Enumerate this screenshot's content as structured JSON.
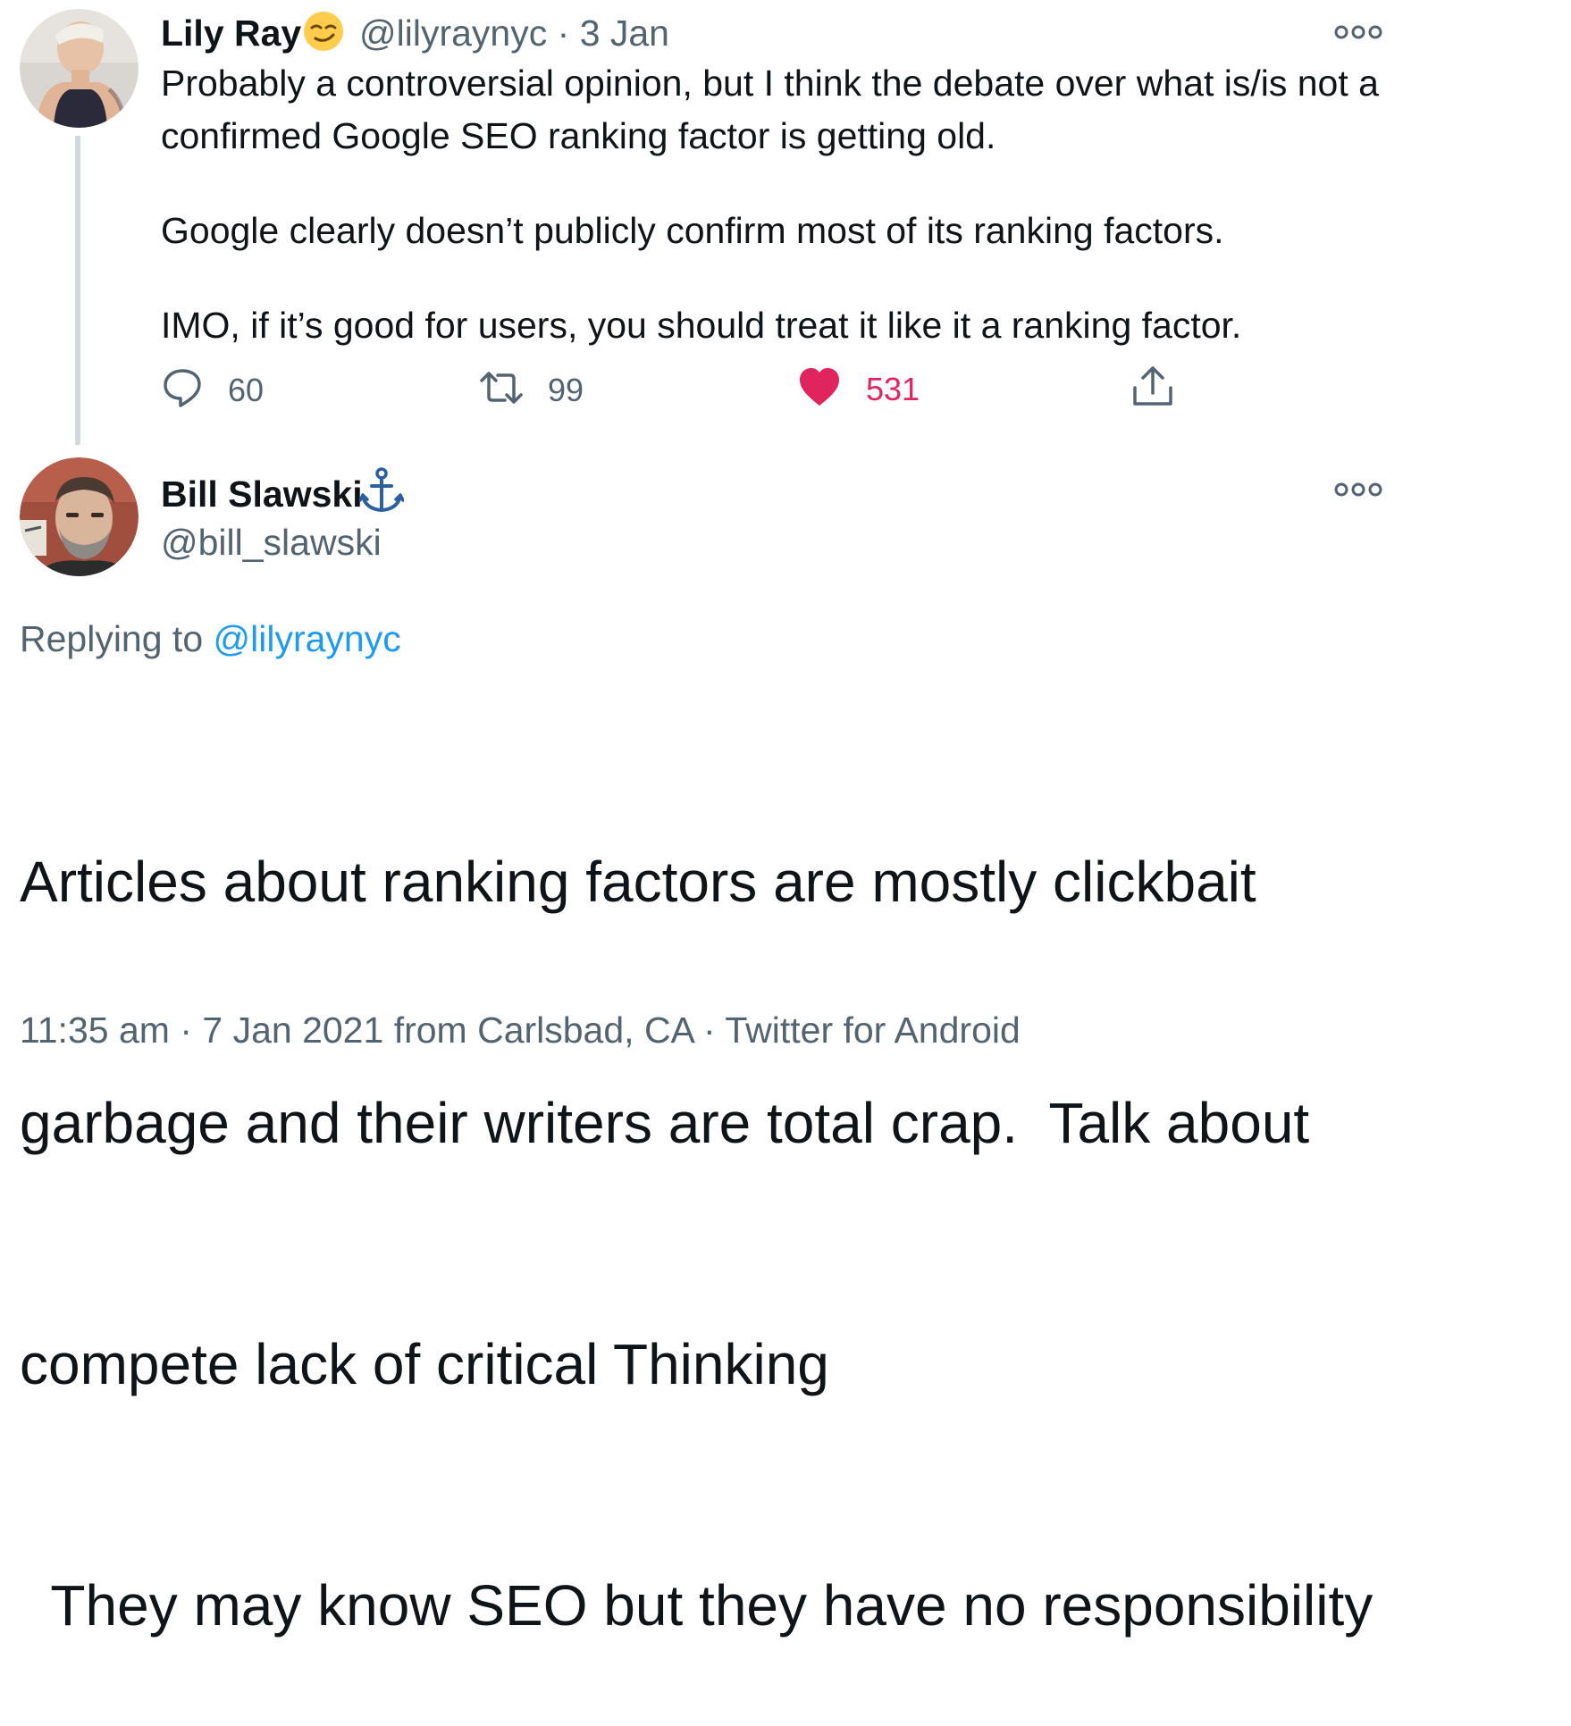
{
  "tweet1": {
    "name": "Lily Ray",
    "emoji": "smirk-emoji",
    "handle": "@lilyraynyc",
    "sep": "·",
    "date": "3 Jan",
    "lines": [
      "Probably a controversial opinion, but I think the debate over what is/is not a",
      "confirmed Google SEO ranking factor is getting old.",
      "Google clearly doesn’t publicly confirm most of its ranking factors.",
      "IMO, if it’s good for users, you should treat it like it a ranking factor."
    ],
    "actions": {
      "replies": "60",
      "retweets": "99",
      "likes": "531"
    },
    "like_color": "#e0245e"
  },
  "tweet2": {
    "name": "Bill Slawski",
    "badge": "anchor-icon",
    "handle": "@bill_slawski",
    "replying_label": "Replying to",
    "replying_handle": "@lilyraynyc",
    "lines": [
      "Articles about ranking factors are mostly clickbait",
      "garbage and their writers are total crap.  Talk about",
      "compete lack of critical Thinking",
      "  They may know SEO but they have no responsibility"
    ],
    "time": "11:35 am",
    "sep1": "·",
    "date": "7 Jan 2021",
    "location": "from Carlsbad, CA",
    "sep2": "·",
    "client": "Twitter for Android"
  },
  "colors": {
    "link": "#1d9bf0",
    "muted": "#536471",
    "anchor": "#2b5f9e"
  }
}
